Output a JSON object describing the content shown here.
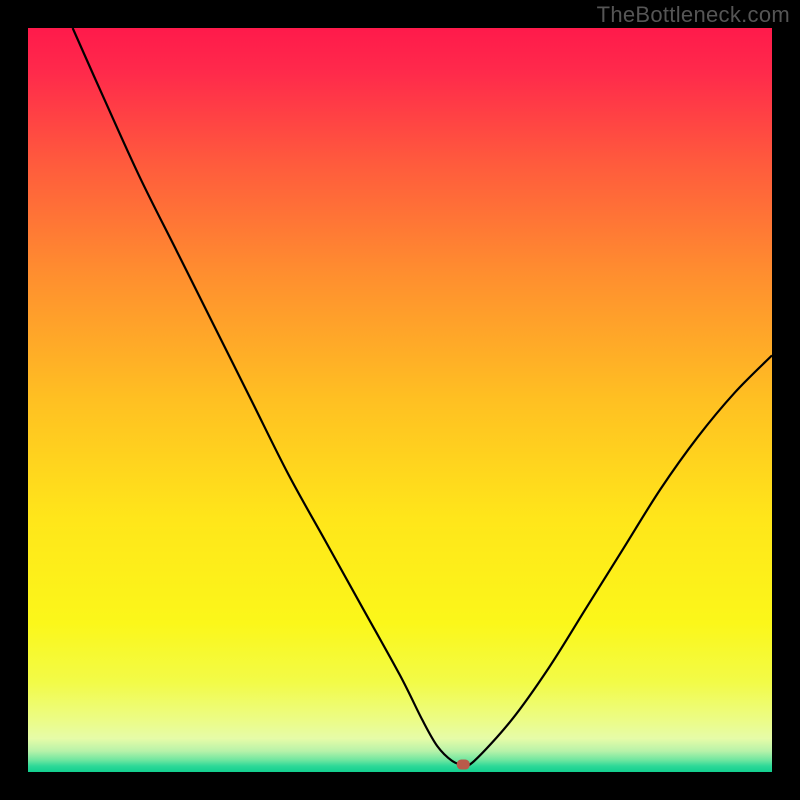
{
  "watermark": "TheBottleneck.com",
  "colors": {
    "frame_border": "#000000",
    "curve": "#000000",
    "marker": "#b95a4a",
    "gradient_top": "#ff1a4b",
    "gradient_bottom": "#12cf8f"
  },
  "chart_data": {
    "type": "line",
    "title": "",
    "xlabel": "",
    "ylabel": "",
    "xlim": [
      0,
      100
    ],
    "ylim": [
      0,
      100
    ],
    "grid": false,
    "legend": false,
    "series": [
      {
        "name": "bottleneck-curve",
        "x": [
          6,
          10,
          15,
          20,
          25,
          30,
          35,
          40,
          45,
          50,
          53,
          55,
          57,
          58.5,
          60,
          65,
          70,
          75,
          80,
          85,
          90,
          95,
          100
        ],
        "y": [
          100,
          91,
          80,
          70,
          60,
          50,
          40,
          31,
          22,
          13,
          7,
          3.5,
          1.5,
          1,
          1.5,
          7,
          14,
          22,
          30,
          38,
          45,
          51,
          56
        ]
      }
    ],
    "marker": {
      "x": 58.5,
      "y": 1,
      "shape": "rounded-rect",
      "color": "#b95a4a"
    },
    "background": {
      "type": "vertical-gradient",
      "description": "red (top) → orange → yellow → pale yellow → green (bottom)"
    }
  }
}
